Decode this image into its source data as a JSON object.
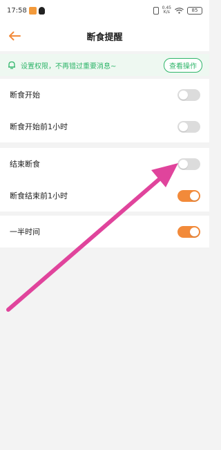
{
  "status_bar": {
    "time": "17:58",
    "net_speed_top": "0.45",
    "net_speed_bottom": "K/s",
    "battery": "85"
  },
  "header": {
    "title": "断食提醒"
  },
  "notice": {
    "text": "设置权限，不再错过重要消息~",
    "button_label": "查看操作"
  },
  "groups": [
    {
      "rows": [
        {
          "label": "断食开始",
          "toggle_on": false
        },
        {
          "label": "断食开始前1小时",
          "toggle_on": false
        }
      ]
    },
    {
      "rows": [
        {
          "label": "结束断食",
          "toggle_on": false
        },
        {
          "label": "断食结束前1小时",
          "toggle_on": true
        }
      ]
    },
    {
      "rows": [
        {
          "label": "一半时间",
          "toggle_on": true
        }
      ]
    }
  ],
  "colors": {
    "accent": "#f28a3a",
    "notice_green": "#2fb56a",
    "annotation_arrow": "#e0449c"
  }
}
